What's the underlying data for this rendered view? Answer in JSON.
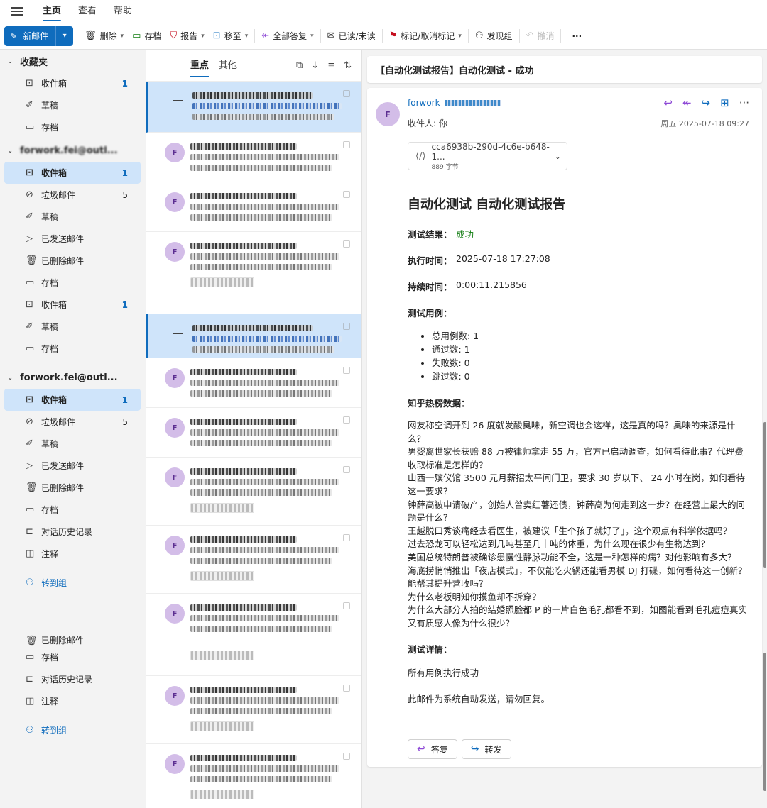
{
  "menu": {
    "tabs": [
      "主页",
      "查看",
      "帮助"
    ]
  },
  "toolbar": {
    "new_mail": "新邮件",
    "delete": "删除",
    "archive": "存档",
    "report": "报告",
    "move": "移至",
    "reply_all": "全部答复",
    "read_unread": "已读/未读",
    "flag": "标记/取消标记",
    "discover_groups": "发现组",
    "undo": "撤消",
    "more": "···"
  },
  "nav": {
    "favorites": {
      "title": "收藏夹",
      "items": [
        {
          "label": "收件箱",
          "count": "1"
        },
        {
          "label": "草稿",
          "count": ""
        },
        {
          "label": "存档",
          "count": ""
        }
      ]
    },
    "account1": {
      "title": "forwork.fei@outl...",
      "items": [
        {
          "label": "收件箱",
          "count": "1"
        },
        {
          "label": "垃圾邮件",
          "count": "5"
        },
        {
          "label": "草稿",
          "count": ""
        },
        {
          "label": "已发送邮件",
          "count": ""
        },
        {
          "label": "已删除邮件",
          "count": ""
        },
        {
          "label": "存档",
          "count": ""
        },
        {
          "label": "收件箱",
          "count": "1"
        },
        {
          "label": "草稿",
          "count": ""
        },
        {
          "label": "存档",
          "count": ""
        }
      ]
    },
    "account2": {
      "title": "forwork.fei@outl...",
      "items": [
        {
          "label": "收件箱",
          "count": "1"
        },
        {
          "label": "垃圾邮件",
          "count": "5"
        },
        {
          "label": "草稿",
          "count": ""
        },
        {
          "label": "已发送邮件",
          "count": ""
        },
        {
          "label": "已删除邮件",
          "count": ""
        },
        {
          "label": "存档",
          "count": ""
        },
        {
          "label": "对话历史记录",
          "count": ""
        },
        {
          "label": "注释",
          "count": ""
        }
      ],
      "go_groups": "转到组"
    },
    "account3": {
      "items": [
        {
          "label": "已删除邮件"
        },
        {
          "label": "存档"
        },
        {
          "label": "对话历史记录"
        },
        {
          "label": "注释"
        }
      ],
      "go_groups": "转到组"
    }
  },
  "list": {
    "tabs": [
      "重点",
      "其他"
    ]
  },
  "reading": {
    "subject": "【自动化测试报告】自动化测试 - 成功",
    "avatar": "F",
    "sender": "forwork",
    "to": "收件人: 你",
    "date": "周五 2025-07-18 09:27",
    "attachment": {
      "name": "cca6938b-290d-4c6e-b648-1...",
      "size": "889 字节"
    },
    "title": "自动化测试 自动化测试报告",
    "result_label": "测试结果：",
    "result_value": "成功",
    "time_label": "执行时间：",
    "time_value": "2025-07-18 17:27:08",
    "duration_label": "持续时间：",
    "duration_value": "0:00:11.215856",
    "cases_label": "测试用例：",
    "cases": [
      "总用例数: 1",
      "通过数: 1",
      "失败数: 0",
      "跳过数: 0"
    ],
    "hot_label": "知乎热榜数据：",
    "hot_lines": [
      "网友称空调开到 26 度就发酸臭味，新空调也会这样，这是真的吗？臭味的来源是什么？",
      "男婴离世家长获赔 88 万被律师拿走 55 万，官方已启动调查，如何看待此事？代理费收取标准是怎样的？",
      "山西一殡仪馆 3500 元月薪招太平间门卫，要求 30 岁以下、 24 小时在岗，如何看待这一要求？",
      "钟薛高被申请破产，创始人曾卖红薯还债，钟薛高为何走到这一步？在经营上最大的问题是什么？",
      "王越脱口秀谈痛经去看医生，被建议「生个孩子就好了」，这个观点有科学依据吗？",
      "过去恐龙可以轻松达到几吨甚至几十吨的体重，为什么现在很少有生物达到？",
      "美国总统特朗普被确诊患慢性静脉功能不全，这是一种怎样的病？对他影响有多大？",
      "海底捞悄悄推出「夜店模式」，不仅能吃火锅还能看男模 DJ 打碟，如何看待这一创新？能帮其提升营收吗？",
      "为什么老板明知你摸鱼却不拆穿？",
      "为什么大部分人拍的结婚照脸都 P 的一片白色毛孔都看不到，如图能看到毛孔痘痘真实又有质感人像为什么很少？"
    ],
    "detail_label": "测试详情：",
    "detail_value": "所有用例执行成功",
    "footer": "此邮件为系统自动发送，请勿回复。",
    "reply": "答复",
    "forward": "转发"
  }
}
